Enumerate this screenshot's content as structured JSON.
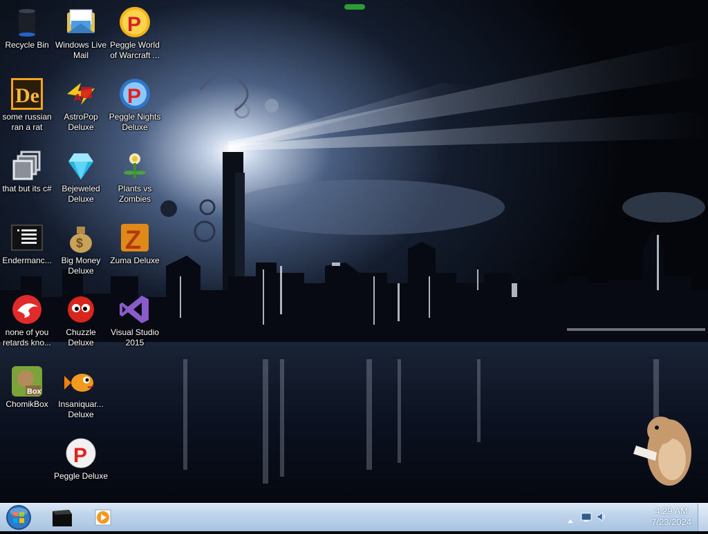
{
  "desktop": {
    "icons": [
      {
        "name": "recycle-bin",
        "label": "Recycle Bin",
        "icon": "recycle-bin-icon"
      },
      {
        "name": "windows-live-mail",
        "label": "Windows Live Mail",
        "icon": "mail-icon"
      },
      {
        "name": "peggle-world-of-warcraft",
        "label": "Peggle World of Warcraft ...",
        "icon": "peggle-icon"
      },
      {
        "name": "some-russian-ran-a-rat",
        "label": "some russian ran a rat",
        "icon": "de-icon"
      },
      {
        "name": "astropop-deluxe",
        "label": "AstroPop Deluxe",
        "icon": "astropop-icon"
      },
      {
        "name": "peggle-nights-deluxe",
        "label": "Peggle Nights Deluxe",
        "icon": "peggle-nights-icon"
      },
      {
        "name": "that-but-its-csharp",
        "label": "that but its c#",
        "icon": "multiwindow-icon"
      },
      {
        "name": "bejeweled-deluxe",
        "label": "Bejeweled Deluxe",
        "icon": "diamond-icon"
      },
      {
        "name": "plants-vs-zombies",
        "label": "Plants vs Zombies",
        "icon": "plants-vs-zombies-icon"
      },
      {
        "name": "endermanch",
        "label": "Endermanc...",
        "icon": "console-icon"
      },
      {
        "name": "big-money-deluxe",
        "label": "Big Money Deluxe",
        "icon": "money-bag-icon"
      },
      {
        "name": "zuma-deluxe",
        "label": "Zuma Deluxe",
        "icon": "zuma-icon"
      },
      {
        "name": "none-of-you-retards",
        "label": "none of you retards kno...",
        "icon": "red-bird-icon"
      },
      {
        "name": "chuzzle-deluxe",
        "label": "Chuzzle Deluxe",
        "icon": "chuzzle-icon"
      },
      {
        "name": "visual-studio-2015",
        "label": "Visual Studio 2015",
        "icon": "visual-studio-icon"
      },
      {
        "name": "chomikbox",
        "label": "ChomikBox",
        "icon": "chomikbox-icon"
      },
      {
        "name": "insaniquarium-deluxe",
        "label": "Insaniquar... Deluxe",
        "icon": "fish-icon"
      },
      {
        "name": "peggle-deluxe",
        "label": "Peggle Deluxe",
        "icon": "peggle-ball-icon"
      }
    ]
  },
  "taskbar": {
    "start_icon": "windows-start-orb-icon",
    "pinned": [
      {
        "name": "taskbar-black-box",
        "icon": "black-box-icon"
      },
      {
        "name": "taskbar-media-player",
        "icon": "media-player-icon"
      }
    ],
    "tray": {
      "show_hidden_icon": "chevron-up-icon",
      "network_icon": "network-icon",
      "volume_icon": "volume-icon",
      "time": "4:29 AM",
      "date": "7/23/2024"
    }
  },
  "colors": {
    "taskbar_top": "#d8e6f4",
    "taskbar_bottom": "#a8c3e0",
    "wallpaper_sky": "#0a0e18"
  }
}
